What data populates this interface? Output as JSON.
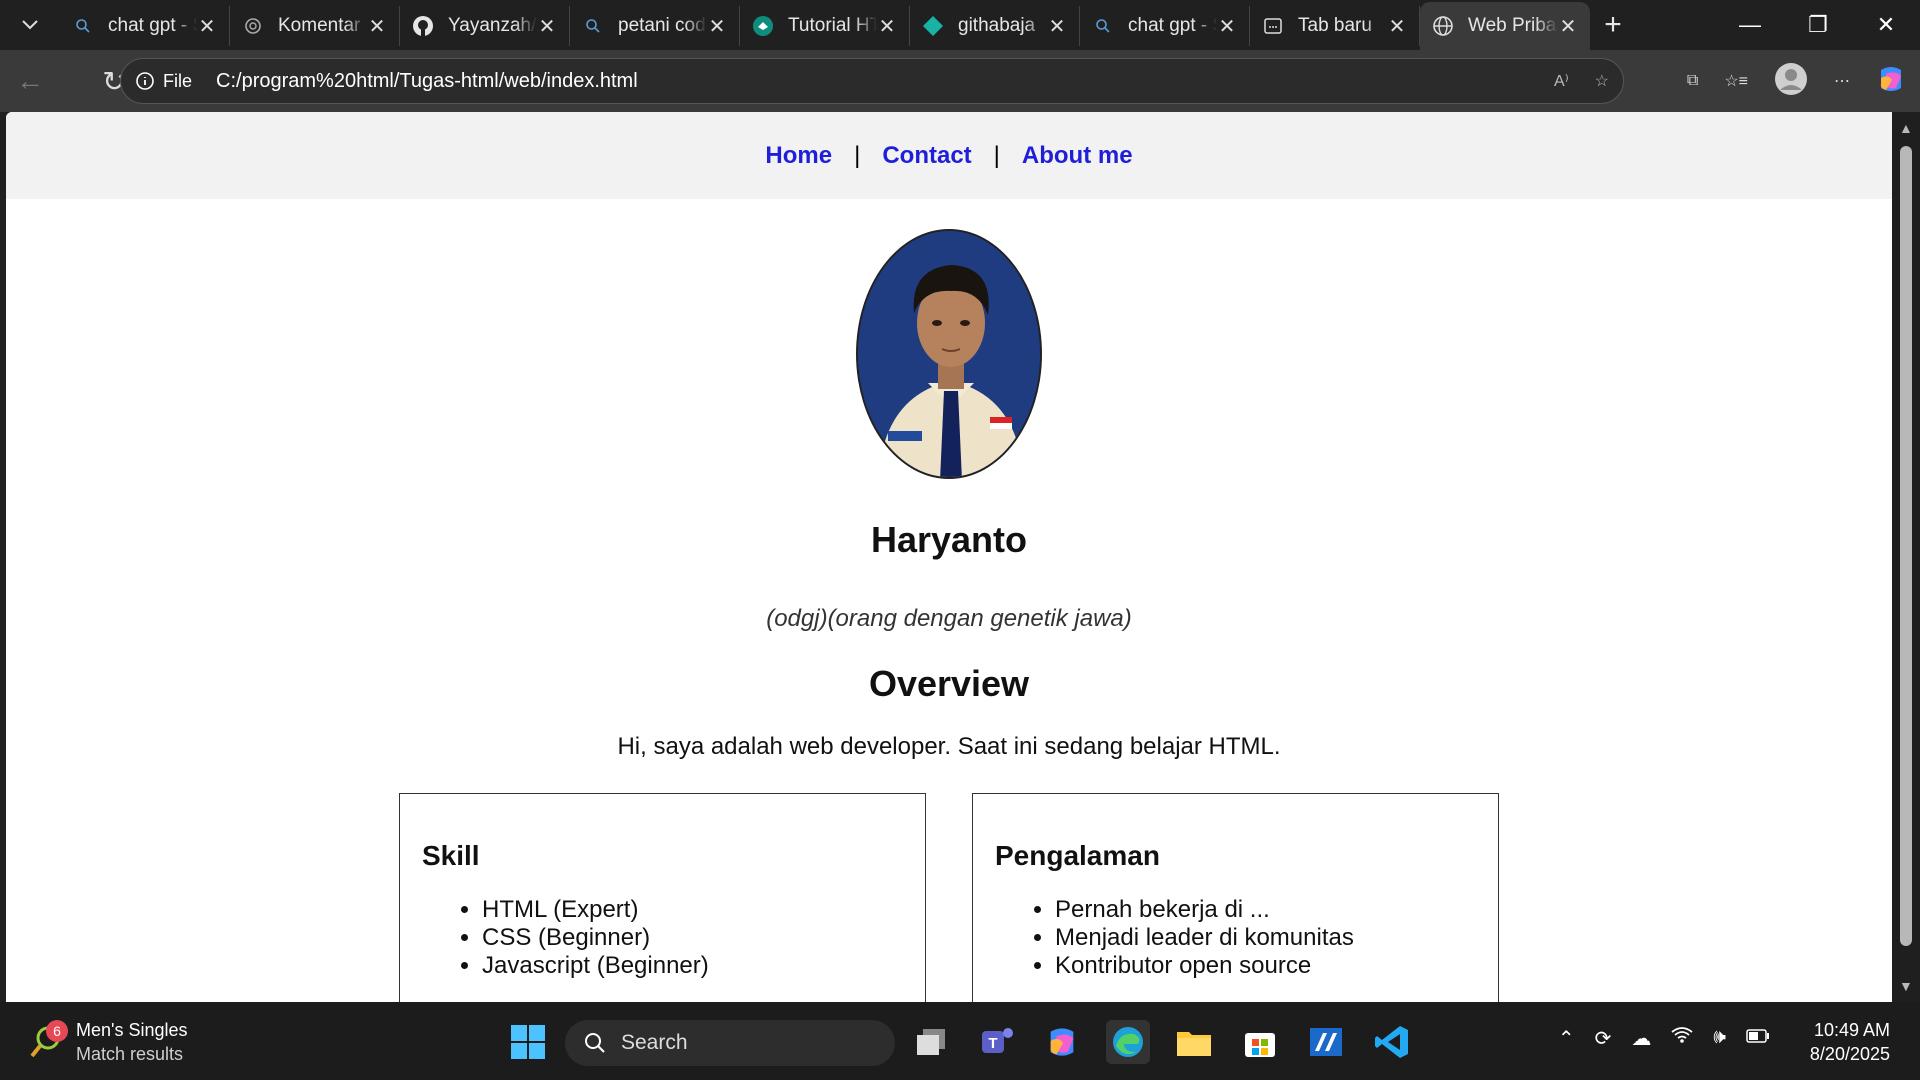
{
  "browser": {
    "tabs": [
      {
        "label": "chat gpt - Search",
        "icon": "search-icon"
      },
      {
        "label": "Komentar",
        "icon": "openai-icon"
      },
      {
        "label": "Yayanzah/",
        "icon": "github-icon"
      },
      {
        "label": "petani code - Search",
        "icon": "search-icon"
      },
      {
        "label": "Tutorial HTML",
        "icon": "tutorial-icon"
      },
      {
        "label": "githabaja",
        "icon": "diamond-icon"
      },
      {
        "label": "chat gpt - Search",
        "icon": "search-icon"
      },
      {
        "label": "Tab baru",
        "icon": "newtab-icon"
      },
      {
        "label": "Web Pribadi",
        "icon": "globe-icon",
        "active": true
      }
    ],
    "address": {
      "scheme_label": "File",
      "url": "C:/program%20html/Tugas-html/web/index.html"
    }
  },
  "page": {
    "nav": {
      "home": "Home",
      "contact": "Contact",
      "about": "About me",
      "sep": "|"
    },
    "profile": {
      "name": "Haryanto",
      "tagline": "(odgj)(orang dengan genetik jawa)"
    },
    "overview": {
      "title": "Overview",
      "text": "Hi, saya adalah web developer. Saat ini sedang belajar HTML."
    },
    "skill": {
      "title": "Skill",
      "items": [
        "HTML (Expert)",
        "CSS (Beginner)",
        "Javascript (Beginner)"
      ]
    },
    "experience": {
      "title": "Pengalaman",
      "items": [
        "Pernah bekerja di ...",
        "Menjadi leader di komunitas",
        "Kontributor open source"
      ]
    }
  },
  "taskbar": {
    "widget": {
      "badge": "6",
      "title": "Men's Singles",
      "subtitle": "Match results"
    },
    "search_placeholder": "Search",
    "clock": {
      "time": "10:49 AM",
      "date": "8/20/2025"
    }
  },
  "colors": {
    "link": "#1f1fd9",
    "nav_bg": "#f2f2f2",
    "chrome_bg": "#202020"
  }
}
